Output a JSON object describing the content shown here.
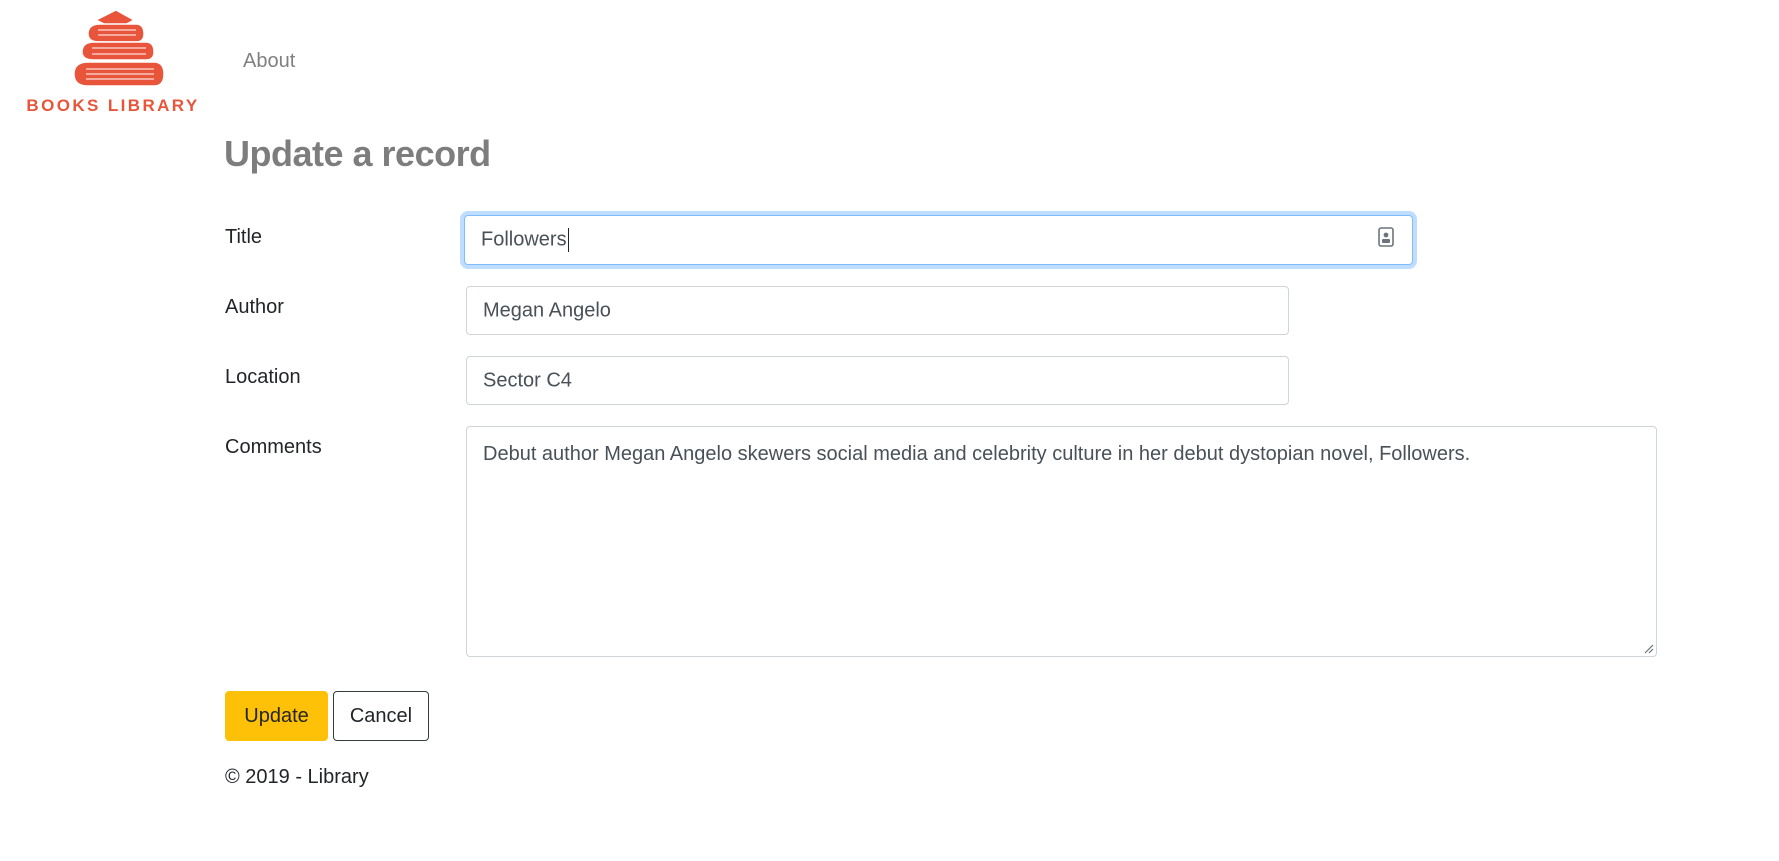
{
  "brand": {
    "name": "BOOKS LIBRARY",
    "icon": "book-stack-logo",
    "color": "#e8553a"
  },
  "nav": {
    "about": "About"
  },
  "page": {
    "title": "Update a record"
  },
  "form": {
    "title_label": "Title",
    "title_value": "Followers",
    "author_label": "Author",
    "author_value": "Megan Angelo",
    "location_label": "Location",
    "location_value": "Sector C4",
    "comments_label": "Comments",
    "comments_value": "Debut author Megan Angelo skewers social media and celebrity culture in her debut dystopian novel, Followers."
  },
  "buttons": {
    "update": "Update",
    "cancel": "Cancel"
  },
  "footer": {
    "text": "© 2019 - Library"
  },
  "colors": {
    "accent": "#ffc107",
    "focus": "#80bdff",
    "heading": "#7d7d7d"
  }
}
